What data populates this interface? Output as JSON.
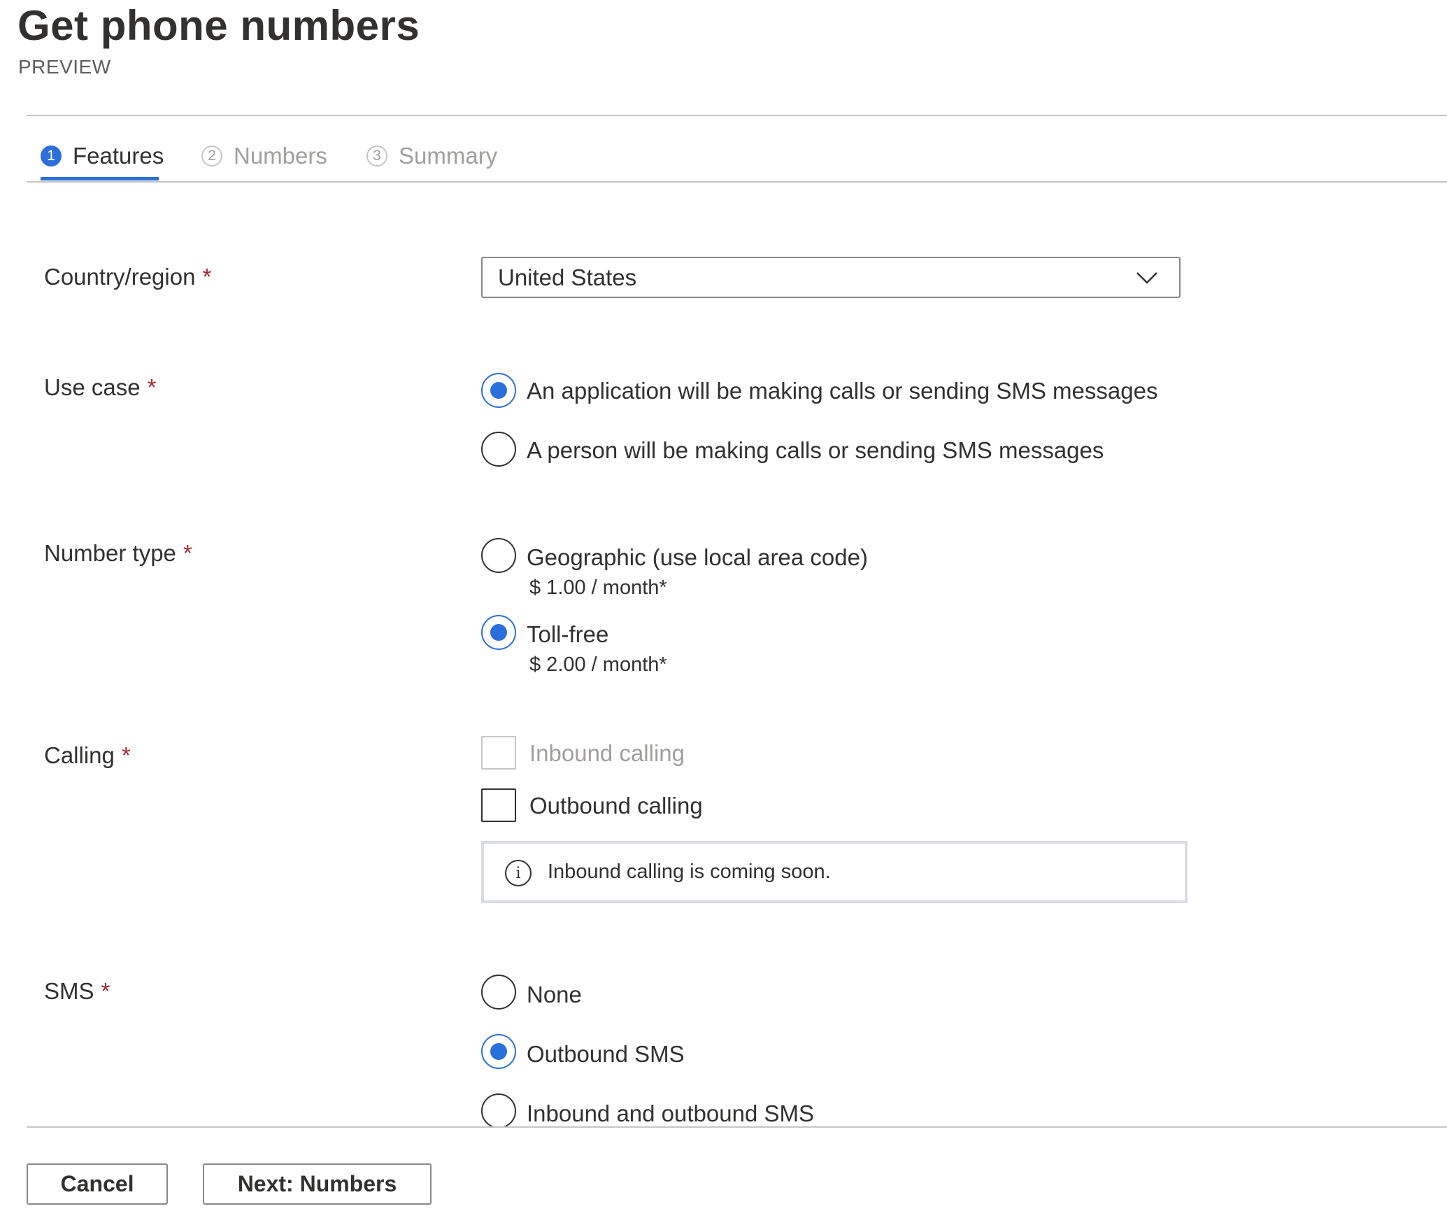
{
  "header": {
    "title": "Get phone numbers",
    "subtitle": "PREVIEW"
  },
  "tabs": [
    {
      "number": "1",
      "label": "Features",
      "active": true
    },
    {
      "number": "2",
      "label": "Numbers",
      "active": false
    },
    {
      "number": "3",
      "label": "Summary",
      "active": false
    }
  ],
  "form": {
    "required_marker": "*",
    "country": {
      "label": "Country/region",
      "value": "United States"
    },
    "use_case": {
      "label": "Use case",
      "options": [
        {
          "label": "An application will be making calls or sending SMS messages",
          "checked": true
        },
        {
          "label": "A person will be making calls or sending SMS messages",
          "checked": false
        }
      ]
    },
    "number_type": {
      "label": "Number type",
      "options": [
        {
          "label": "Geographic (use local area code)",
          "price": "$ 1.00 / month*",
          "checked": false
        },
        {
          "label": "Toll-free",
          "price": "$ 2.00 / month*",
          "checked": true
        }
      ]
    },
    "calling": {
      "label": "Calling",
      "options": [
        {
          "label": "Inbound calling",
          "checked": false,
          "disabled": true
        },
        {
          "label": "Outbound calling",
          "checked": false,
          "disabled": false
        }
      ],
      "info": "Inbound calling is coming soon."
    },
    "sms": {
      "label": "SMS",
      "options": [
        {
          "label": "None",
          "checked": false
        },
        {
          "label": "Outbound SMS",
          "checked": true
        },
        {
          "label": "Inbound and outbound SMS",
          "checked": false
        }
      ]
    }
  },
  "footer": {
    "cancel_label": "Cancel",
    "next_label": "Next: Numbers"
  },
  "colors": {
    "accent": "#2a6fdb",
    "required": "#a4262c",
    "disabled_text": "#a19f9d"
  },
  "icons": {
    "dropdown": "chevron-down-icon",
    "info": "info-icon"
  }
}
